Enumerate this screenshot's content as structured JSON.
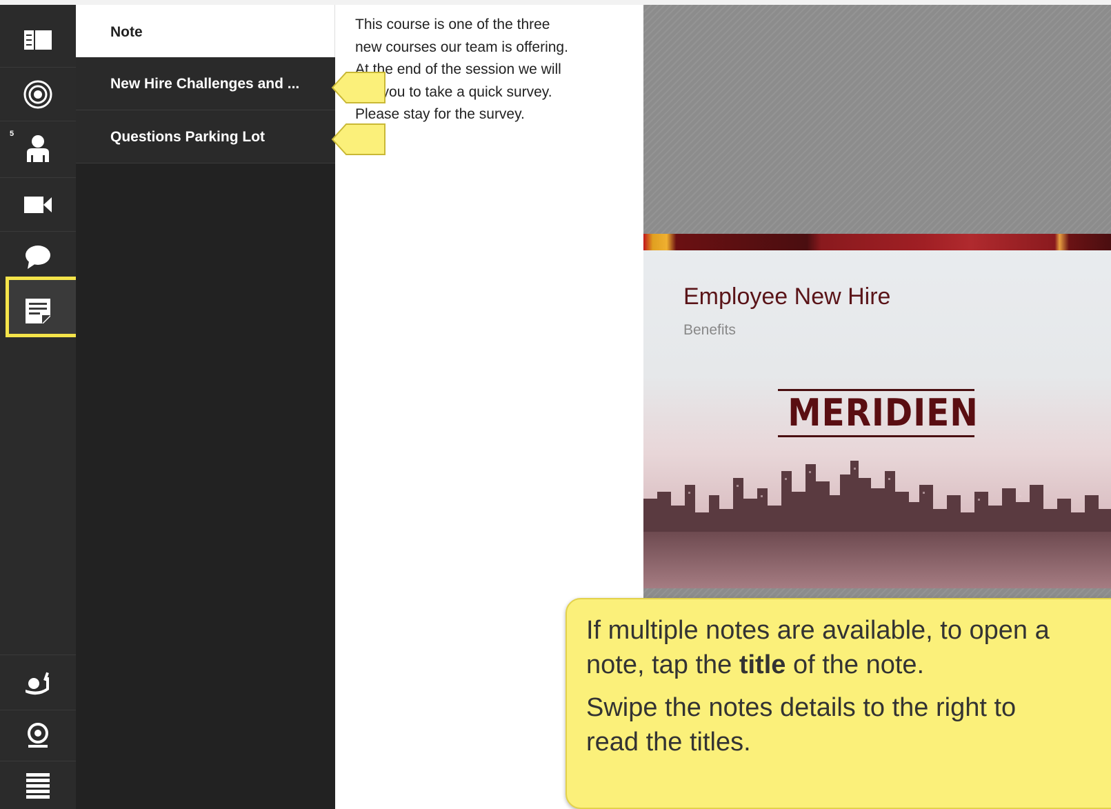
{
  "rail": {
    "badge": "5",
    "icons": [
      "layout-icon",
      "target-icon",
      "attendees-icon",
      "camera-icon",
      "chat-icon",
      "notes-icon",
      "raise-hand-icon",
      "webcam-icon",
      "menu-icon"
    ]
  },
  "notes_panel": {
    "header": "Note",
    "items": [
      {
        "label": "New Hire Challenges and ..."
      },
      {
        "label": "Questions Parking Lot"
      }
    ]
  },
  "note_body": {
    "line1": "This course is one of the three",
    "line2": "new courses our team is offering.",
    "line3": "At the end of the session we will",
    "line4": "ask you to take a quick survey.",
    "line5": "Please stay for the survey."
  },
  "slide": {
    "title": "Employee New Hire",
    "subtitle": "Benefits",
    "logo": "MERIDIEN"
  },
  "instruction": {
    "p1_before": "If multiple notes are available, to open a",
    "p1_line2_a": "note, tap the ",
    "p1_bold": "title",
    "p1_line2_b": " of the note.",
    "p2_line1": "Swipe the notes details to the right to",
    "p2_line2": "read the titles."
  },
  "colors": {
    "rail_bg": "#2b2b2b",
    "panel_bg": "#222222",
    "highlight": "#f4e44a",
    "callout_bg": "#fbf07a",
    "slide_title": "#5a1418"
  }
}
